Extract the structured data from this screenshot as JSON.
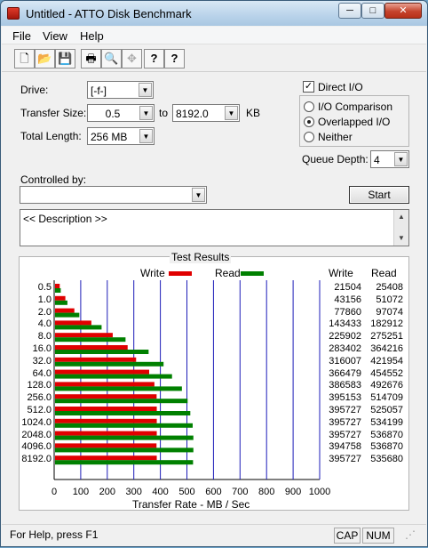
{
  "window": {
    "title": "Untitled - ATTO Disk Benchmark",
    "minimize": "─",
    "maximize": "□",
    "close": "✕"
  },
  "menu": [
    "File",
    "View",
    "Help"
  ],
  "toolbar": {
    "buttons": [
      "new-icon",
      "open-icon",
      "save-icon",
      "print-icon",
      "print-preview-icon",
      "move-icon",
      "help-icon",
      "context-help-icon"
    ],
    "glyphs": [
      "🗋",
      "📂",
      "💾",
      "🖶",
      "🔍",
      "✥",
      "?",
      "?"
    ]
  },
  "settings": {
    "drive_label": "Drive:",
    "drive_value": "[-f-]",
    "transfer_size_label": "Transfer Size:",
    "transfer_from": "0.5",
    "to_label": "to",
    "transfer_to": "8192.0",
    "unit_label": "KB",
    "total_length_label": "Total Length:",
    "total_length_value": "256 MB",
    "direct_io_label": "Direct I/O",
    "direct_io_check": "✓",
    "io_comparison_label": "I/O Comparison",
    "overlapped_io_label": "Overlapped I/O",
    "neither_label": "Neither",
    "queue_depth_label": "Queue Depth:",
    "queue_depth_value": "4",
    "controlled_by_label": "Controlled by:",
    "controlled_by_value": "",
    "start_label": "Start",
    "description": "<< Description >>"
  },
  "results": {
    "title": "Test Results",
    "legend_write": "Write",
    "legend_read": "Read",
    "col_write": "Write",
    "col_read": "Read",
    "write_color": "#e00000",
    "read_color": "#008000"
  },
  "chart_data": {
    "type": "bar",
    "orientation": "horizontal",
    "categories": [
      "0.5",
      "1.0",
      "2.0",
      "4.0",
      "8.0",
      "16.0",
      "32.0",
      "64.0",
      "128.0",
      "256.0",
      "512.0",
      "1024.0",
      "2048.0",
      "4096.0",
      "8192.0"
    ],
    "series": [
      {
        "name": "Write",
        "values": [
          21504,
          43156,
          77860,
          143433,
          225902,
          283402,
          316007,
          366479,
          386583,
          395153,
          395727,
          395727,
          395727,
          394758,
          395727
        ]
      },
      {
        "name": "Read",
        "values": [
          25408,
          51072,
          97074,
          182912,
          275251,
          364216,
          421954,
          454552,
          492676,
          514709,
          525057,
          534199,
          536870,
          536870,
          535680
        ]
      }
    ],
    "xlabel": "Transfer Rate - MB / Sec",
    "xticks": [
      "0",
      "100",
      "200",
      "300",
      "400",
      "500",
      "600",
      "700",
      "800",
      "900",
      "1000"
    ],
    "xlim": [
      0,
      1000
    ],
    "legend": "top"
  },
  "status": {
    "text": "For Help, press F1",
    "cap": "CAP",
    "num": "NUM"
  }
}
